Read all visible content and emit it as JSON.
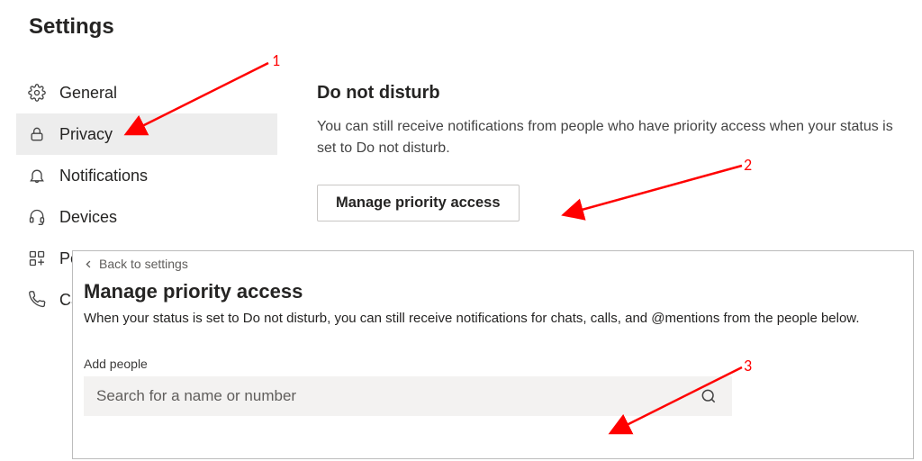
{
  "page_title": "Settings",
  "sidebar": {
    "items": [
      {
        "label": "General"
      },
      {
        "label": "Privacy"
      },
      {
        "label": "Notifications"
      },
      {
        "label": "Devices"
      },
      {
        "label": "Pe"
      },
      {
        "label": "Ca"
      }
    ]
  },
  "main": {
    "heading": "Do not disturb",
    "description": "You can still receive notifications from people who have priority access when your status is set to Do not disturb.",
    "manage_button_label": "Manage priority access"
  },
  "panel": {
    "back_label": "Back to settings",
    "title": "Manage priority access",
    "description": "When your status is set to Do not disturb, you can still receive notifications for chats, calls, and @mentions from the people below.",
    "add_people_label": "Add people",
    "search_placeholder": "Search for a name or number"
  },
  "annotations": {
    "n1": "1",
    "n2": "2",
    "n3": "3"
  },
  "colors": {
    "annotation": "#ff0000"
  }
}
